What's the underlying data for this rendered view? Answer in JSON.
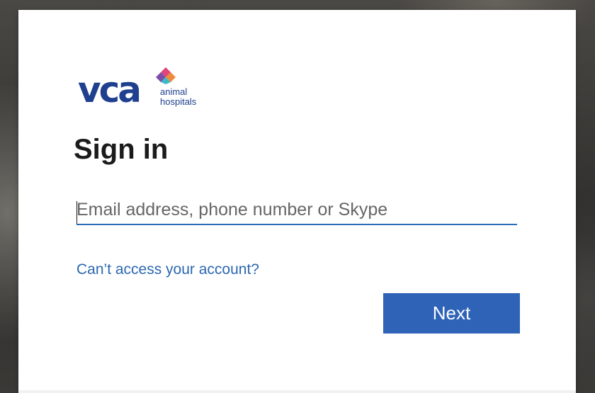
{
  "logo": {
    "wordmark": "vca",
    "subtitle_line1": "animal",
    "subtitle_line2": "hospitals",
    "icon": "diamond-cluster-icon"
  },
  "signin": {
    "title": "Sign in",
    "email_placeholder": "Email address, phone number or Skype",
    "email_value": "",
    "help_link": "Can’t access your account?",
    "next_label": "Next"
  },
  "colors": {
    "brand_blue": "#1f3f8f",
    "link": "#2b67b0",
    "button": "#2e63b8",
    "input_underline": "#2b6cb8",
    "logo_pink": "#e0457b",
    "logo_purple": "#7b4fa8",
    "logo_teal": "#3fb8c4",
    "logo_orange": "#f08a3c"
  }
}
